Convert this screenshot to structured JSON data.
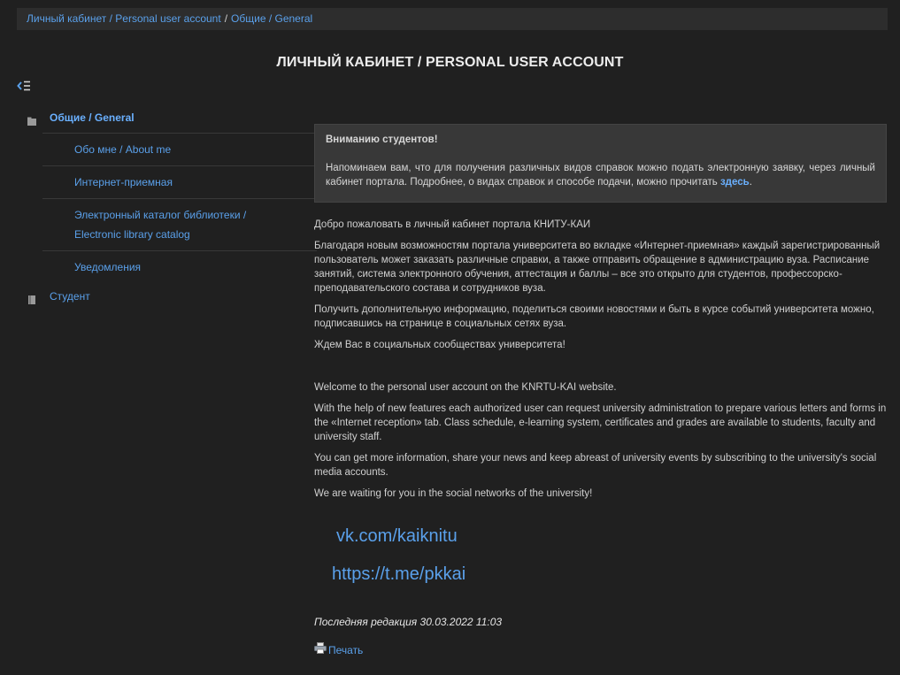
{
  "breadcrumb": {
    "items": [
      "Личный кабинет / Personal user account",
      "Общие / General"
    ],
    "separator": "/"
  },
  "page_title": "ЛИЧНЫЙ КАБИНЕТ / PERSONAL USER ACCOUNT",
  "sidebar": {
    "toggle_icon": "sidebar-collapse-icon",
    "sections": [
      {
        "label": "Общие / General",
        "icon": "folder-icon",
        "active": true,
        "items": [
          {
            "label": "Обо мне / About me"
          },
          {
            "label": "Интернет-приемная"
          },
          {
            "label_line1": "Электронный каталог библиотеки /",
            "label_line2": "Electronic library catalog"
          },
          {
            "label": "Уведомления"
          }
        ]
      },
      {
        "label": "Студент",
        "icon": "book-icon",
        "active": false
      }
    ]
  },
  "notice": {
    "title": "Вниманию студентов!",
    "text": "Напоминаем вам, что для получения различных видов справок можно подать электронную заявку, через личный кабинет портала. Подробнее, о видах справок и способе подачи, можно прочитать",
    "link": "здесь",
    "end": "."
  },
  "ru": {
    "p1": "Добро пожаловать в личный кабинет портала КНИТУ-КАИ",
    "p2": "Благодаря новым возможностям портала университета во вкладке «Интернет-приемная» каждый зарегистрированный пользователь  может заказать различные справки, а также отправить обращение в администрацию вуза. Расписание занятий, система электронного обучения, аттестация и баллы – все это открыто для студентов, профессорско-преподавательского состава и сотрудников вуза.",
    "p3": "Получить дополнительную информацию, поделиться своими новостями и быть в курсе событий университета можно, подписавшись на странице в социальных сетях вуза.",
    "p4": "Ждем Вас в социальных сообществах университета!"
  },
  "en": {
    "p1": "Welcome to the personal user account on the KNRTU-KAI website.",
    "p2": "With the help of new features each authorized user can request university administration to prepare various letters and forms in the «Internet reception» tab. Class schedule, e-learning system, certificates and grades are available to students, faculty and university staff.",
    "p3": "You can get more information, share your news and keep abreast of university events by subscribing to the university's social media accounts.",
    "p4": "We are waiting for you in the social networks of the university!"
  },
  "social": {
    "vk": "vk.com/kaiknitu",
    "telegram": "https://t.me/pkkai"
  },
  "last_modified": "Последняя редакция 30.03.2022 11:03",
  "print_label": "Печать",
  "colors": {
    "background": "#202020",
    "link": "#5aa0ea",
    "notice_bg": "#383838"
  }
}
